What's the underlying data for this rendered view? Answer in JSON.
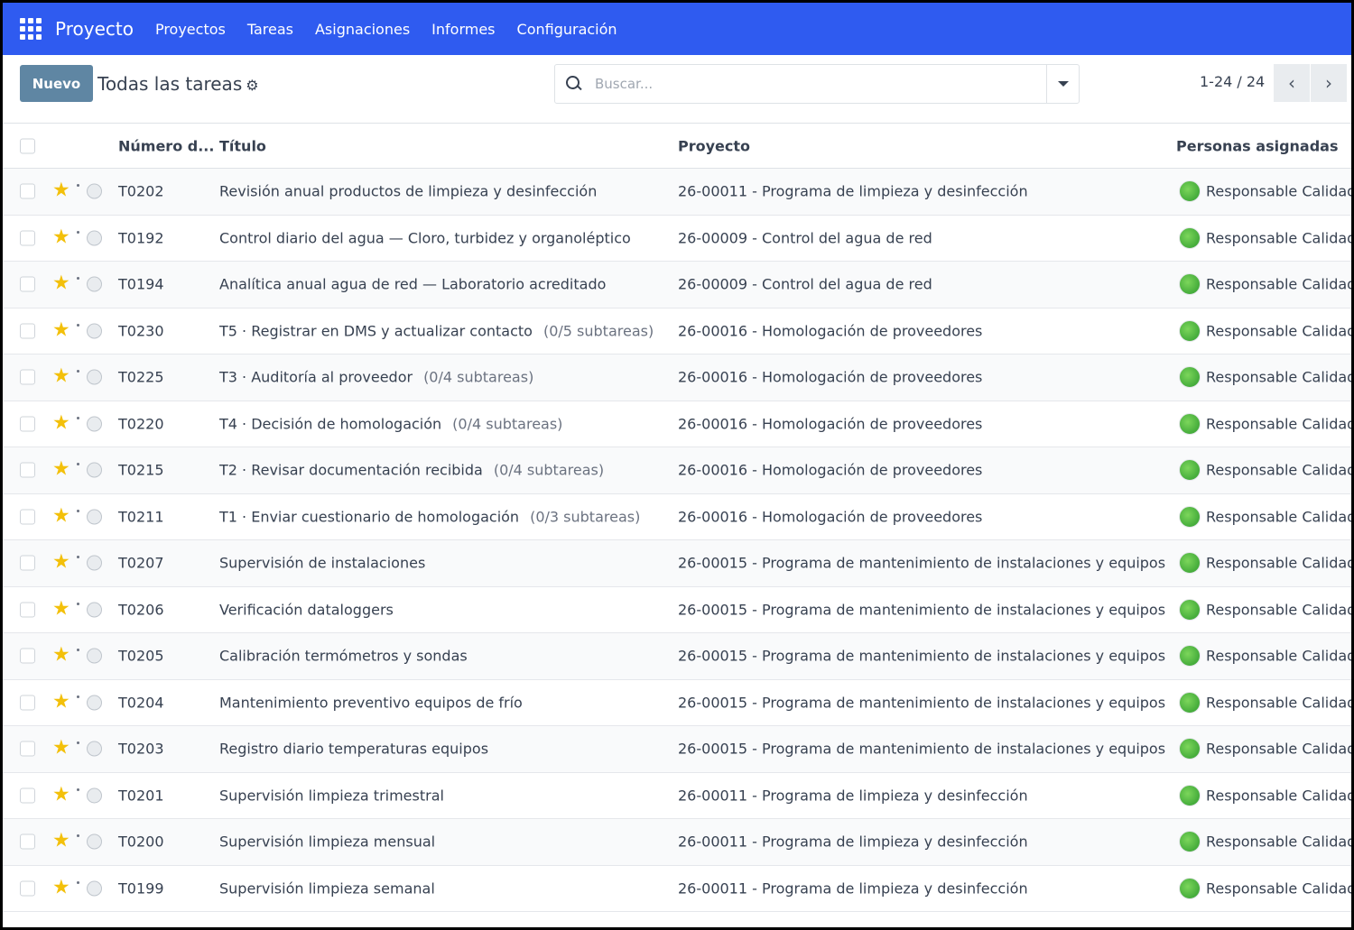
{
  "navbar": {
    "app_name": "Proyecto",
    "menu": [
      "Proyectos",
      "Tareas",
      "Asignaciones",
      "Informes",
      "Configuración"
    ]
  },
  "control": {
    "new_label": "Nuevo",
    "title": "Todas las tareas",
    "search_placeholder": "Buscar...",
    "pager": "1-24 / 24"
  },
  "table": {
    "headers": [
      "Número d...",
      "Título",
      "Proyecto",
      "Personas asignadas"
    ],
    "rows": [
      {
        "num": "T0202",
        "title": "Revisión anual productos de limpieza y desinfección",
        "sub": "",
        "project": "26-00011 - Programa de limpieza y desinfección",
        "assignee": "Responsable Calidad"
      },
      {
        "num": "T0192",
        "title": "Control diario del agua — Cloro, turbidez y organoléptico",
        "sub": "",
        "project": "26-00009 - Control del agua de red",
        "assignee": "Responsable Calidad"
      },
      {
        "num": "T0194",
        "title": "Analítica anual agua de red — Laboratorio acreditado",
        "sub": "",
        "project": "26-00009 - Control del agua de red",
        "assignee": "Responsable Calidad"
      },
      {
        "num": "T0230",
        "title": "T5 · Registrar en DMS y actualizar contacto",
        "sub": "(0/5 subtareas)",
        "project": "26-00016 - Homologación de proveedores",
        "assignee": "Responsable Calidad"
      },
      {
        "num": "T0225",
        "title": "T3 · Auditoría al proveedor",
        "sub": "(0/4 subtareas)",
        "project": "26-00016 - Homologación de proveedores",
        "assignee": "Responsable Calidad"
      },
      {
        "num": "T0220",
        "title": "T4 · Decisión de homologación",
        "sub": "(0/4 subtareas)",
        "project": "26-00016 - Homologación de proveedores",
        "assignee": "Responsable Calidad"
      },
      {
        "num": "T0215",
        "title": "T2 · Revisar documentación recibida",
        "sub": "(0/4 subtareas)",
        "project": "26-00016 - Homologación de proveedores",
        "assignee": "Responsable Calidad"
      },
      {
        "num": "T0211",
        "title": "T1 · Enviar cuestionario de homologación",
        "sub": "(0/3 subtareas)",
        "project": "26-00016 - Homologación de proveedores",
        "assignee": "Responsable Calidad"
      },
      {
        "num": "T0207",
        "title": "Supervisión de instalaciones",
        "sub": "",
        "project": "26-00015 - Programa de mantenimiento de instalaciones y equipos",
        "assignee": "Responsable Calidad"
      },
      {
        "num": "T0206",
        "title": "Verificación dataloggers",
        "sub": "",
        "project": "26-00015 - Programa de mantenimiento de instalaciones y equipos",
        "assignee": "Responsable Calidad"
      },
      {
        "num": "T0205",
        "title": "Calibración termómetros y sondas",
        "sub": "",
        "project": "26-00015 - Programa de mantenimiento de instalaciones y equipos",
        "assignee": "Responsable Calidad"
      },
      {
        "num": "T0204",
        "title": "Mantenimiento preventivo equipos de frío",
        "sub": "",
        "project": "26-00015 - Programa de mantenimiento de instalaciones y equipos",
        "assignee": "Responsable Calidad"
      },
      {
        "num": "T0203",
        "title": "Registro diario temperaturas equipos",
        "sub": "",
        "project": "26-00015 - Programa de mantenimiento de instalaciones y equipos",
        "assignee": "Responsable Calidad"
      },
      {
        "num": "T0201",
        "title": "Supervisión limpieza trimestral",
        "sub": "",
        "project": "26-00011 - Programa de limpieza y desinfección",
        "assignee": "Responsable Calidad"
      },
      {
        "num": "T0200",
        "title": "Supervisión limpieza mensual",
        "sub": "",
        "project": "26-00011 - Programa de limpieza y desinfección",
        "assignee": "Responsable Calidad"
      },
      {
        "num": "T0199",
        "title": "Supervisión limpieza semanal",
        "sub": "",
        "project": "26-00011 - Programa de limpieza y desinfección",
        "assignee": "Responsable Calidad"
      }
    ]
  },
  "colors": {
    "navbar": "#2f5bf0",
    "primary_button": "#5f86a3",
    "star": "#f3c00a"
  }
}
